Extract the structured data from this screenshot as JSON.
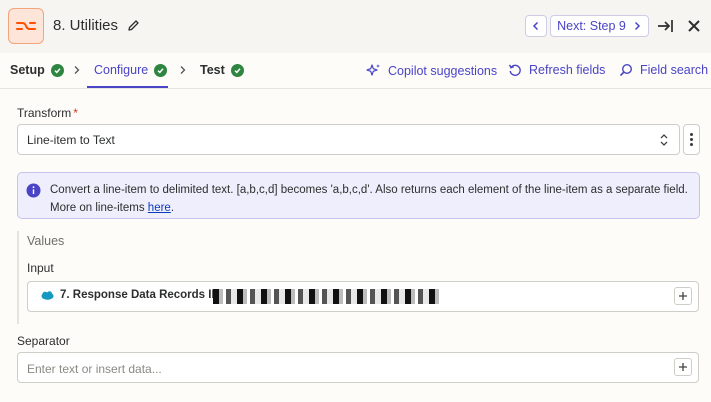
{
  "header": {
    "title": "8. Utilities",
    "next_label": "Next: Step 9"
  },
  "tabs": [
    {
      "label": "Setup",
      "status": "complete"
    },
    {
      "label": "Configure",
      "status": "complete",
      "active": true
    },
    {
      "label": "Test",
      "status": "complete"
    }
  ],
  "tools": {
    "copilot": "Copilot suggestions",
    "refresh": "Refresh fields",
    "search": "Field search"
  },
  "transform": {
    "label": "Transform",
    "required_mark": "*",
    "value": "Line-item to Text"
  },
  "info": {
    "text": "Convert a line-item to delimited text. [a,b,c,d] becomes 'a,b,c,d'. Also returns each element of the line-item as a separate field. More on line-items ",
    "link": "here",
    "suffix": "."
  },
  "values": {
    "title": "Values",
    "input_label": "Input",
    "input_pill": "7. Response Data Records ID:"
  },
  "separator": {
    "label": "Separator",
    "placeholder": "Enter text or insert data..."
  },
  "colors": {
    "accent": "#4a44c6",
    "success": "#2e8540",
    "brand": "#ff4f00"
  }
}
